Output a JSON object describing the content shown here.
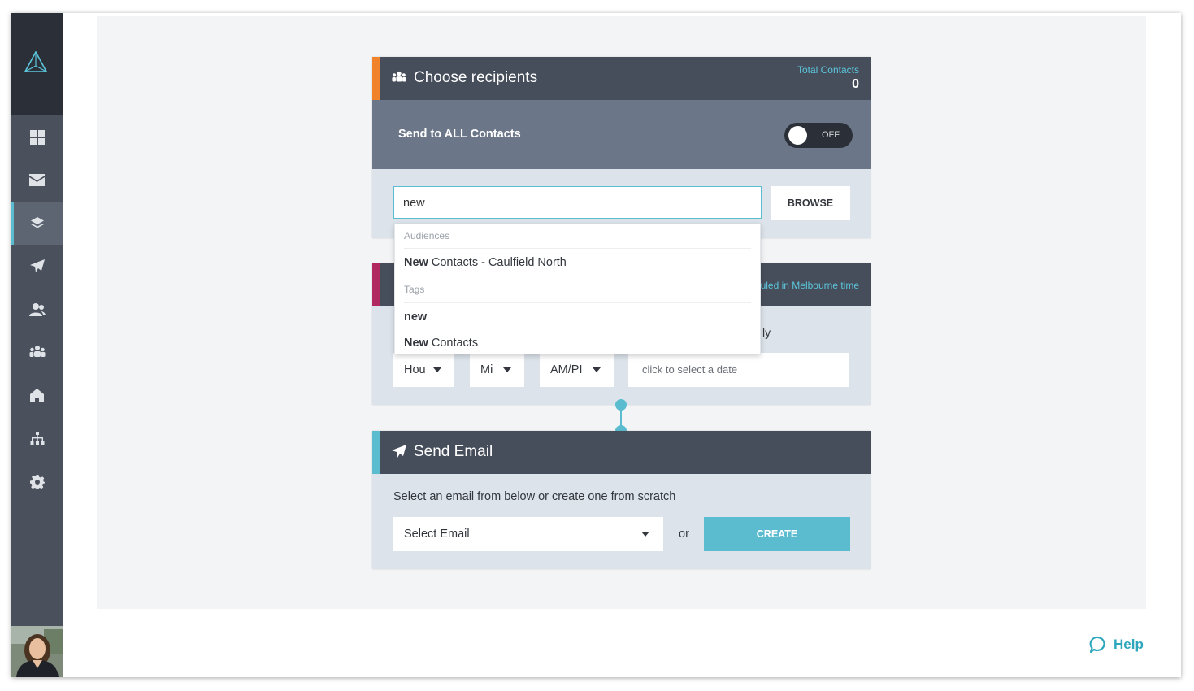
{
  "sidebar": {
    "logo_icon": "triangle-logo-icon",
    "items": [
      {
        "icon": "dashboard-grid-icon",
        "active": false
      },
      {
        "icon": "envelope-icon",
        "active": false
      },
      {
        "icon": "layers-icon",
        "active": true
      },
      {
        "icon": "paper-plane-icon",
        "active": false
      },
      {
        "icon": "contacts-icon",
        "active": false
      },
      {
        "icon": "group-icon",
        "active": false
      },
      {
        "icon": "home-icon",
        "active": false
      },
      {
        "icon": "sitemap-icon",
        "active": false
      },
      {
        "icon": "gear-icon",
        "active": false
      }
    ],
    "avatar_icon": "user-avatar"
  },
  "recipients": {
    "title": "Choose recipients",
    "accent": "#f0832a",
    "total_label": "Total Contacts",
    "total_value": "0",
    "send_all_label": "Send to ALL Contacts",
    "toggle_text": "OFF",
    "search_value": "new",
    "browse_label": "BROWSE"
  },
  "dropdown": {
    "group_audiences": "Audiences",
    "audience_bold": "New",
    "audience_rest": " Contacts - Caulfield North",
    "group_tags": "Tags",
    "tag1_bold": "new",
    "tag2_bold": "New",
    "tag2_rest": " Contacts"
  },
  "schedule": {
    "accent": "#b0285f",
    "tz_fragment": "uled in Melbourne time",
    "frag_text": "ly",
    "hour_placeholder": "Hou",
    "minute_placeholder": "Mi",
    "ampm_placeholder": "AM/PI",
    "date_placeholder": "click to select a date"
  },
  "email": {
    "title": "Send Email",
    "accent": "#5bbcd0",
    "description": "Select an email from below or create one from scratch",
    "select_placeholder": "Select Email",
    "or_text": "or",
    "create_label": "CREATE"
  },
  "help": {
    "label": "Help"
  }
}
